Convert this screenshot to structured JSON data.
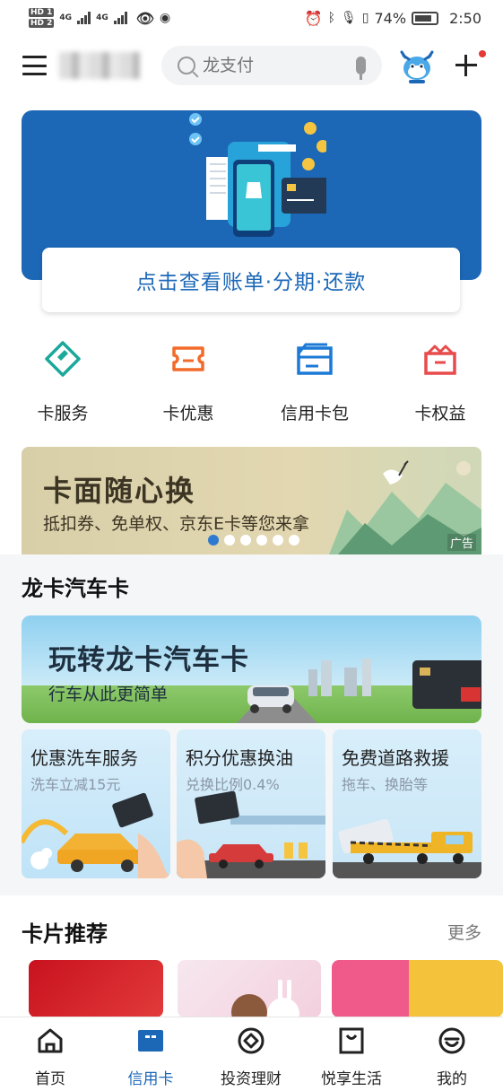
{
  "status_bar": {
    "hd1": "HD 1",
    "hd2": "HD 2",
    "net1": "4G",
    "net2": "4G",
    "battery": "74%",
    "time": "2:50"
  },
  "header": {
    "search_placeholder": "龙支付"
  },
  "bill_banner": {
    "action_text": "点击查看账单·分期·还款"
  },
  "services": [
    {
      "label": "卡服务",
      "icon": "card-service-icon",
      "color": "#1aa89a"
    },
    {
      "label": "卡优惠",
      "icon": "coupon-icon",
      "color": "#f26b2a"
    },
    {
      "label": "信用卡包",
      "icon": "card-wallet-icon",
      "color": "#1c7ad6"
    },
    {
      "label": "卡权益",
      "icon": "crown-icon",
      "color": "#e84b4b"
    }
  ],
  "promo": {
    "title": "卡面随心换",
    "subtitle": "抵扣券、免单权、京东E卡等您来拿",
    "ad_label": "广告",
    "dots_total": 6,
    "dots_active": 1
  },
  "car_section": {
    "title": "龙卡汽车卡",
    "banner_title": "玩转龙卡汽车卡",
    "banner_subtitle": "行车从此更简单",
    "tiles": [
      {
        "title": "优惠洗车服务",
        "subtitle": "洗车立减15元"
      },
      {
        "title": "积分优惠换油",
        "subtitle": "兑换比例0.4%"
      },
      {
        "title": "免费道路救援",
        "subtitle": "拖车、换胎等"
      }
    ]
  },
  "recommend": {
    "title": "卡片推荐",
    "more": "更多"
  },
  "tabbar": {
    "tabs": [
      {
        "label": "首页",
        "icon": "home-icon"
      },
      {
        "label": "信用卡",
        "icon": "credit-card-icon",
        "active": true
      },
      {
        "label": "投资理财",
        "icon": "invest-icon"
      },
      {
        "label": "悦享生活",
        "icon": "life-bag-icon"
      },
      {
        "label": "我的",
        "icon": "profile-icon"
      }
    ]
  },
  "colors": {
    "brand_blue": "#1c68b7",
    "active_dot": "#2f7ad1",
    "notify_red": "#e53935"
  }
}
